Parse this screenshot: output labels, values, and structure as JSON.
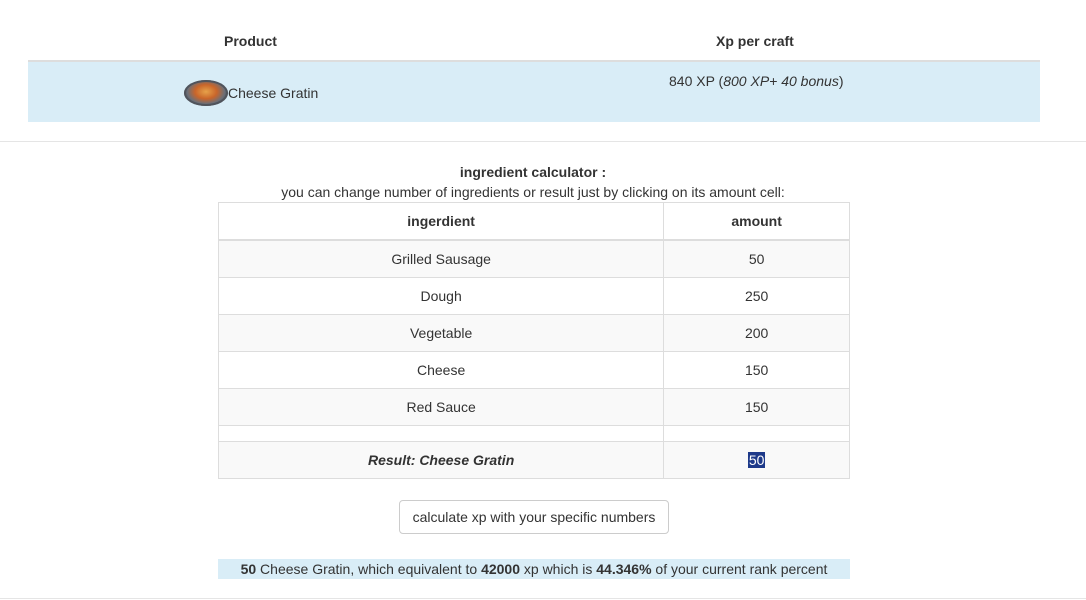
{
  "product_table": {
    "headers": {
      "product": "Product",
      "xp_per_craft": "Xp per craft"
    },
    "row": {
      "icon": "cheese-gratin-dish-icon",
      "name": "Cheese Gratin",
      "xp_prefix": "840 XP (",
      "xp_detail": "800 XP+ 40 bonus",
      "xp_suffix": ")"
    }
  },
  "calculator": {
    "title": "ingredient calculator :",
    "subtitle": "you can change number of ingredients or result just by clicking on its amount cell:",
    "headers": {
      "ingredient": "ingerdient",
      "amount": "amount"
    },
    "rows": [
      {
        "ingredient": "Grilled Sausage",
        "amount": "50"
      },
      {
        "ingredient": "Dough",
        "amount": "250"
      },
      {
        "ingredient": "Vegetable",
        "amount": "200"
      },
      {
        "ingredient": "Cheese",
        "amount": "150"
      },
      {
        "ingredient": "Red Sauce",
        "amount": "150"
      }
    ],
    "result_label": "Result: Cheese Gratin",
    "result_amount": "50",
    "button_label": "calculate xp with your specific numbers"
  },
  "summary": {
    "count": "50",
    "text1": " Cheese Gratin, which equivalent to ",
    "xp": "42000",
    "text2": " xp which is ",
    "percent": "44.346%",
    "text3": " of your current rank percent"
  },
  "colors": {
    "highlight_row": "#d9edf7",
    "selection": "#1e3a8a"
  }
}
